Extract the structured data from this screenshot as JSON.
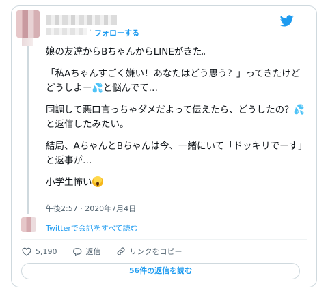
{
  "header": {
    "follow_label": "フォローする",
    "separator": "·"
  },
  "tweet": {
    "paragraphs": [
      "娘の友達からBちゃんからLINEがきた。",
      "「私Aちゃんすごく嫌い！あなたはどう思う？」ってきたけどどうしよー",
      "と悩んでて…",
      "同調して悪口言っちゃダメだよって伝えたら、どうしたの？",
      "と返信したみたい。",
      "結局、AちゃんとBちゃんは今、一緒にいて「ドッキリでーす」と返事が…",
      "小学生怖い"
    ],
    "emoji_drops": "💦",
    "timestamp": "午後2:57 · 2020年7月4日"
  },
  "conversation": {
    "link_label": "Twitterで会話をすべて読む"
  },
  "actions": {
    "like_count": "5,190",
    "reply_label": "返信",
    "copy_link_label": "リンクをコピー"
  },
  "read_replies_label": "56件の返信を読む",
  "colors": {
    "accent": "#1d9bf0",
    "text": "#0f1419",
    "muted": "#536471",
    "border": "#cfd9de"
  },
  "icons": [
    "twitter-bird-icon",
    "heart-icon",
    "reply-icon",
    "link-icon",
    "sweat-drops-emoji",
    "screaming-face-emoji"
  ]
}
